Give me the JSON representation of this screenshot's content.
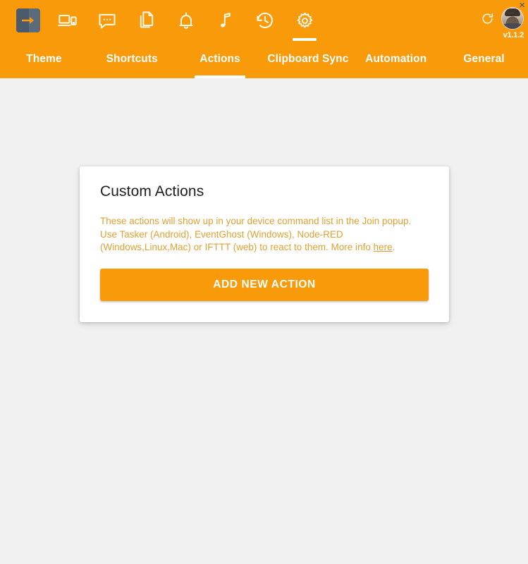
{
  "app": {
    "version": "v1.1.2",
    "accent_color": "#F99A0B",
    "background_color": "#F0F0F0",
    "description_color": "#E0A030"
  },
  "header": {
    "icons": [
      {
        "name": "join-logo-icon",
        "label": "Join"
      },
      {
        "name": "devices-icon",
        "label": "Devices"
      },
      {
        "name": "chat-icon",
        "label": "Messages"
      },
      {
        "name": "files-icon",
        "label": "Files"
      },
      {
        "name": "bell-icon",
        "label": "Notifications"
      },
      {
        "name": "music-note-icon",
        "label": "Media"
      },
      {
        "name": "history-icon",
        "label": "History"
      },
      {
        "name": "gear-icon",
        "label": "Settings"
      }
    ],
    "active_icon_index": 7,
    "refresh_label": "Refresh",
    "avatar_label": "Account",
    "window_controls": {
      "minimize": "_",
      "close": "×"
    }
  },
  "tabs": {
    "items": [
      {
        "label": "Theme"
      },
      {
        "label": "Shortcuts"
      },
      {
        "label": "Actions"
      },
      {
        "label": "Clipboard Sync"
      },
      {
        "label": "Automation"
      },
      {
        "label": "General"
      }
    ],
    "active_index": 2
  },
  "card": {
    "title": "Custom Actions",
    "description_part1": "These actions will show up in your device command list in the Join popup. Use Tasker (Android), EventGhost (Windows), Node-RED (Windows,Linux,Mac) or IFTTT (web) to react to them. More info ",
    "description_link": "here",
    "description_part2": ".",
    "add_button_label": "ADD NEW ACTION"
  }
}
